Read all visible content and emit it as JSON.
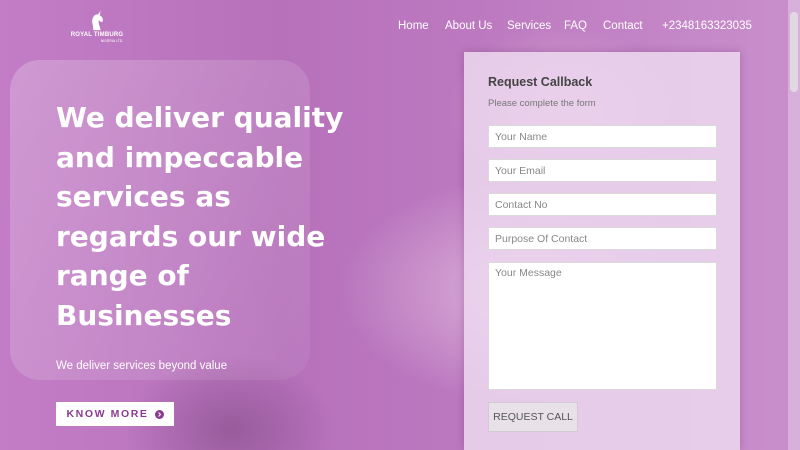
{
  "brand": {
    "name": "ROYAL TIMBURG",
    "subtitle": "NIGERIA LTD."
  },
  "nav": {
    "items": [
      "Home",
      "About Us",
      "Services",
      "FAQ",
      "Contact"
    ],
    "phone": "+2348163323035"
  },
  "hero": {
    "headline": "We deliver quality and impeccable services as regards our wide range of Businesses",
    "subline": "We deliver services beyond value",
    "cta_label": "KNOW MORE"
  },
  "form": {
    "title": "Request Callback",
    "subtitle": "Please complete the form",
    "name_placeholder": "Your Name",
    "email_placeholder": "Your Email",
    "contact_placeholder": "Contact No",
    "purpose_placeholder": "Purpose Of Contact",
    "message_placeholder": "Your Message",
    "submit_label": "REQUEST CALL"
  },
  "colors": {
    "overlay": "#b86bbd",
    "accent": "#8a3b8f"
  },
  "icons": {
    "logo": "unicorn-logo-icon",
    "cta": "arrow-right-circle-icon"
  }
}
